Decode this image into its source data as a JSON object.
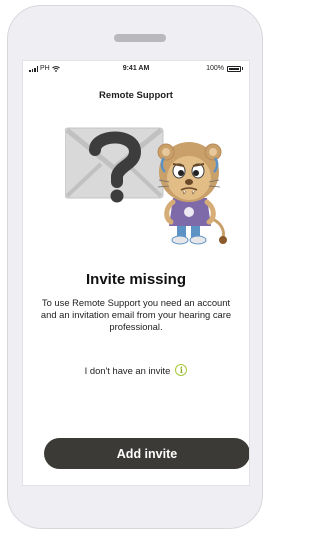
{
  "status_bar": {
    "carrier": "PH",
    "time": "9:41 AM",
    "battery": "100%"
  },
  "screen": {
    "title": "Remote Support",
    "heading": "Invite missing",
    "description": "To use Remote Support you need an account and an invitation email from your hearing care professional.",
    "no_invite_text": "I don't have an invite",
    "info_icon": "info-icon",
    "add_button_label": "Add invite"
  },
  "illustration": {
    "envelope_icon": "envelope-icon",
    "question_icon": "question-mark-icon",
    "mascot": "lion-mascot"
  },
  "colors": {
    "button": "#3b3a37",
    "accent": "#a6c838"
  }
}
